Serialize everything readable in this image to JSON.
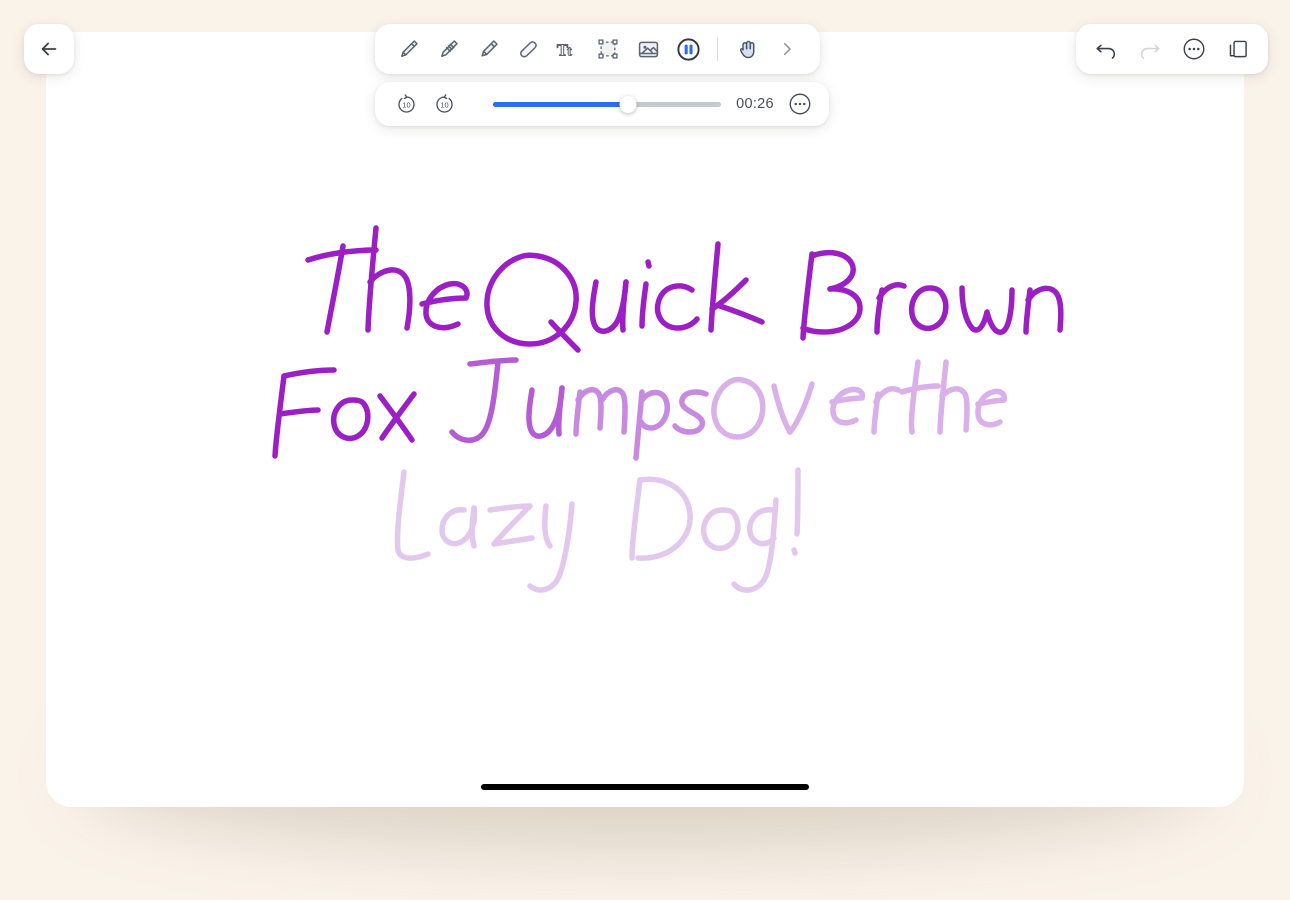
{
  "app": {
    "background_color": "#faf3ea",
    "device_surface_color": "#ffffff"
  },
  "navigation": {
    "back_label": "Back",
    "back_icon": "arrow-left-icon"
  },
  "toolbar": {
    "tools": [
      {
        "id": "pen",
        "label": "Pen",
        "icon": "pen-icon",
        "selected": false
      },
      {
        "id": "pencil",
        "label": "Pencil",
        "icon": "pencil-icon",
        "selected": false
      },
      {
        "id": "highlighter",
        "label": "Highlighter",
        "icon": "highlighter-icon",
        "selected": false
      },
      {
        "id": "eraser",
        "label": "Eraser",
        "icon": "eraser-icon",
        "selected": false
      },
      {
        "id": "text",
        "label": "Text",
        "icon": "text-tool-icon",
        "selected": false
      },
      {
        "id": "select",
        "label": "Select",
        "icon": "lasso-select-icon",
        "selected": false
      },
      {
        "id": "image",
        "label": "Insert Image",
        "icon": "image-icon",
        "selected": false
      },
      {
        "id": "pause",
        "label": "Pause",
        "icon": "pause-circle-icon",
        "selected": true
      }
    ],
    "hand_tool": {
      "id": "hand",
      "label": "Hand",
      "icon": "hand-icon"
    },
    "expand": {
      "id": "expand",
      "label": "More tools",
      "icon": "chevron-right-icon"
    },
    "accent_color": "#2f6bf0"
  },
  "playback": {
    "skip_back": {
      "label": "Back 10 seconds",
      "icon": "rewind-10-icon",
      "seconds": "10"
    },
    "skip_forward": {
      "label": "Forward 10 seconds",
      "icon": "forward-10-icon",
      "seconds": "10"
    },
    "current_time": "00:26",
    "progress_percent": 59,
    "fill_color": "#2f6bf0",
    "track_color": "#c6c9ce",
    "more_options": {
      "label": "Playback options",
      "icon": "ellipsis-circle-icon"
    }
  },
  "actions": [
    {
      "id": "undo",
      "label": "Undo",
      "icon": "undo-icon",
      "enabled": true
    },
    {
      "id": "redo",
      "label": "Redo",
      "icon": "redo-icon",
      "enabled": false
    },
    {
      "id": "more",
      "label": "More",
      "icon": "ellipsis-circle-icon",
      "enabled": true
    },
    {
      "id": "pages",
      "label": "Pages",
      "icon": "pages-icon",
      "enabled": true
    }
  ],
  "canvas": {
    "note_text": "The Quick Brown Fox Jumps Over the Lazy Dog!",
    "ink_color_full": "#9b1fc4",
    "ink_color_faded": "#e6cfee",
    "lines": [
      {
        "text": "The Quick Brown",
        "opacity": "full"
      },
      {
        "text": "Fox Jumps Over the",
        "opacity": "fading"
      },
      {
        "text": "Lazy Dog!",
        "opacity": "faded"
      }
    ]
  },
  "home_indicator": {
    "label": "Home indicator",
    "color": "#000000"
  }
}
